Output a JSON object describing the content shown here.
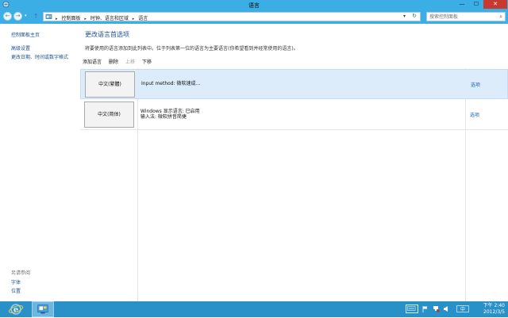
{
  "window": {
    "title": "语言",
    "minimize": "—",
    "maximize": "☐",
    "close": "✕"
  },
  "nav": {
    "breadcrumbs": [
      "控制面板",
      "时钟、语言和区域",
      "语言"
    ],
    "search_placeholder": "搜索控制面板"
  },
  "sidebar": {
    "home": "控制面板主页",
    "links": [
      "高级设置",
      "更改日期、时间或数字格式"
    ],
    "see_also_title": "另请参阅",
    "see_also": [
      "字体",
      "位置"
    ]
  },
  "main": {
    "heading": "更改语言首选项",
    "description": "将要使用的语言添加到此列表中。位于列表第一位的语言为主要语言(你希望看到并经常使用的语言)。",
    "toolbar": {
      "add": "添加语言",
      "remove": "删除",
      "move_up": "上移",
      "move_down": "下移"
    },
    "languages": [
      {
        "name": "中文(繁體)",
        "info_line1": "Input method: 微软速成...",
        "info_line2": "",
        "options": "选项"
      },
      {
        "name": "中文(简体)",
        "info_line1": "Windows 显示语言: 已启用",
        "info_line2": "输入法: 微软拼音简捷",
        "options": "选项"
      }
    ]
  },
  "taskbar": {
    "time": "下午 2:40",
    "date": "2012/3/5"
  },
  "colors": {
    "titlebar": "#3aaee5",
    "taskbar": "#2a90c8",
    "link": "#1a4f8f",
    "selected_row": "#dcecfb",
    "close_button": "#c7382f"
  }
}
